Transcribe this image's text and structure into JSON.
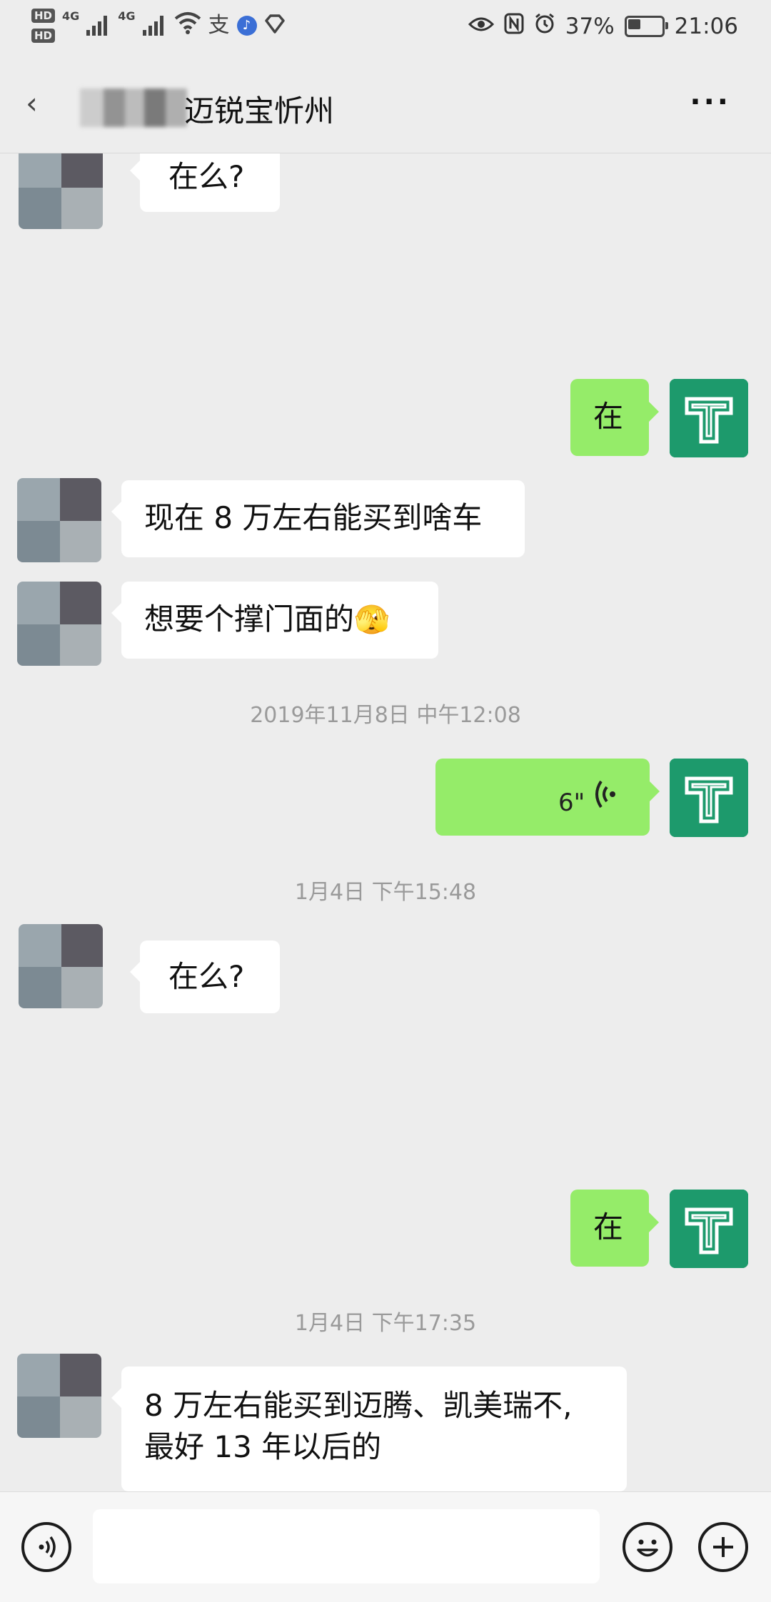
{
  "status_bar": {
    "hd1": "HD",
    "hd2": "HD",
    "net1": "4G",
    "net2": "4G",
    "battery_percent": "37%",
    "time": "21:06"
  },
  "header": {
    "title": "迈锐宝忻州",
    "more_label": "···"
  },
  "messages": [
    {
      "side": "in",
      "text": "在么?"
    },
    {
      "side": "out",
      "text": "在"
    },
    {
      "side": "in",
      "text": "现在 8 万左右能买到啥车"
    },
    {
      "side": "in",
      "text": "想要个撑门面的",
      "emoji": "🫣"
    },
    {
      "side": "out",
      "type": "voice",
      "duration": "6\""
    },
    {
      "side": "in",
      "text": "在么?"
    },
    {
      "side": "out",
      "text": "在"
    },
    {
      "side": "in",
      "text_line1": "8 万左右能买到迈腾、凯美瑞不,",
      "text_line2": "最好 13 年以后的"
    }
  ],
  "timestamps": [
    "2019年11月8日 中午12:08",
    "1月4日 下午15:48",
    "1月4日 下午17:35"
  ],
  "colors": {
    "bubble_out": "#95ec69",
    "bubble_in": "#ffffff",
    "avatar_me": "#1d9a6c",
    "background": "#ededed"
  },
  "icons": {
    "voice_toggle": "voice-icon",
    "emoji": "emoji-icon",
    "plus": "plus-icon",
    "voice_wave": "voice-wave-icon"
  }
}
